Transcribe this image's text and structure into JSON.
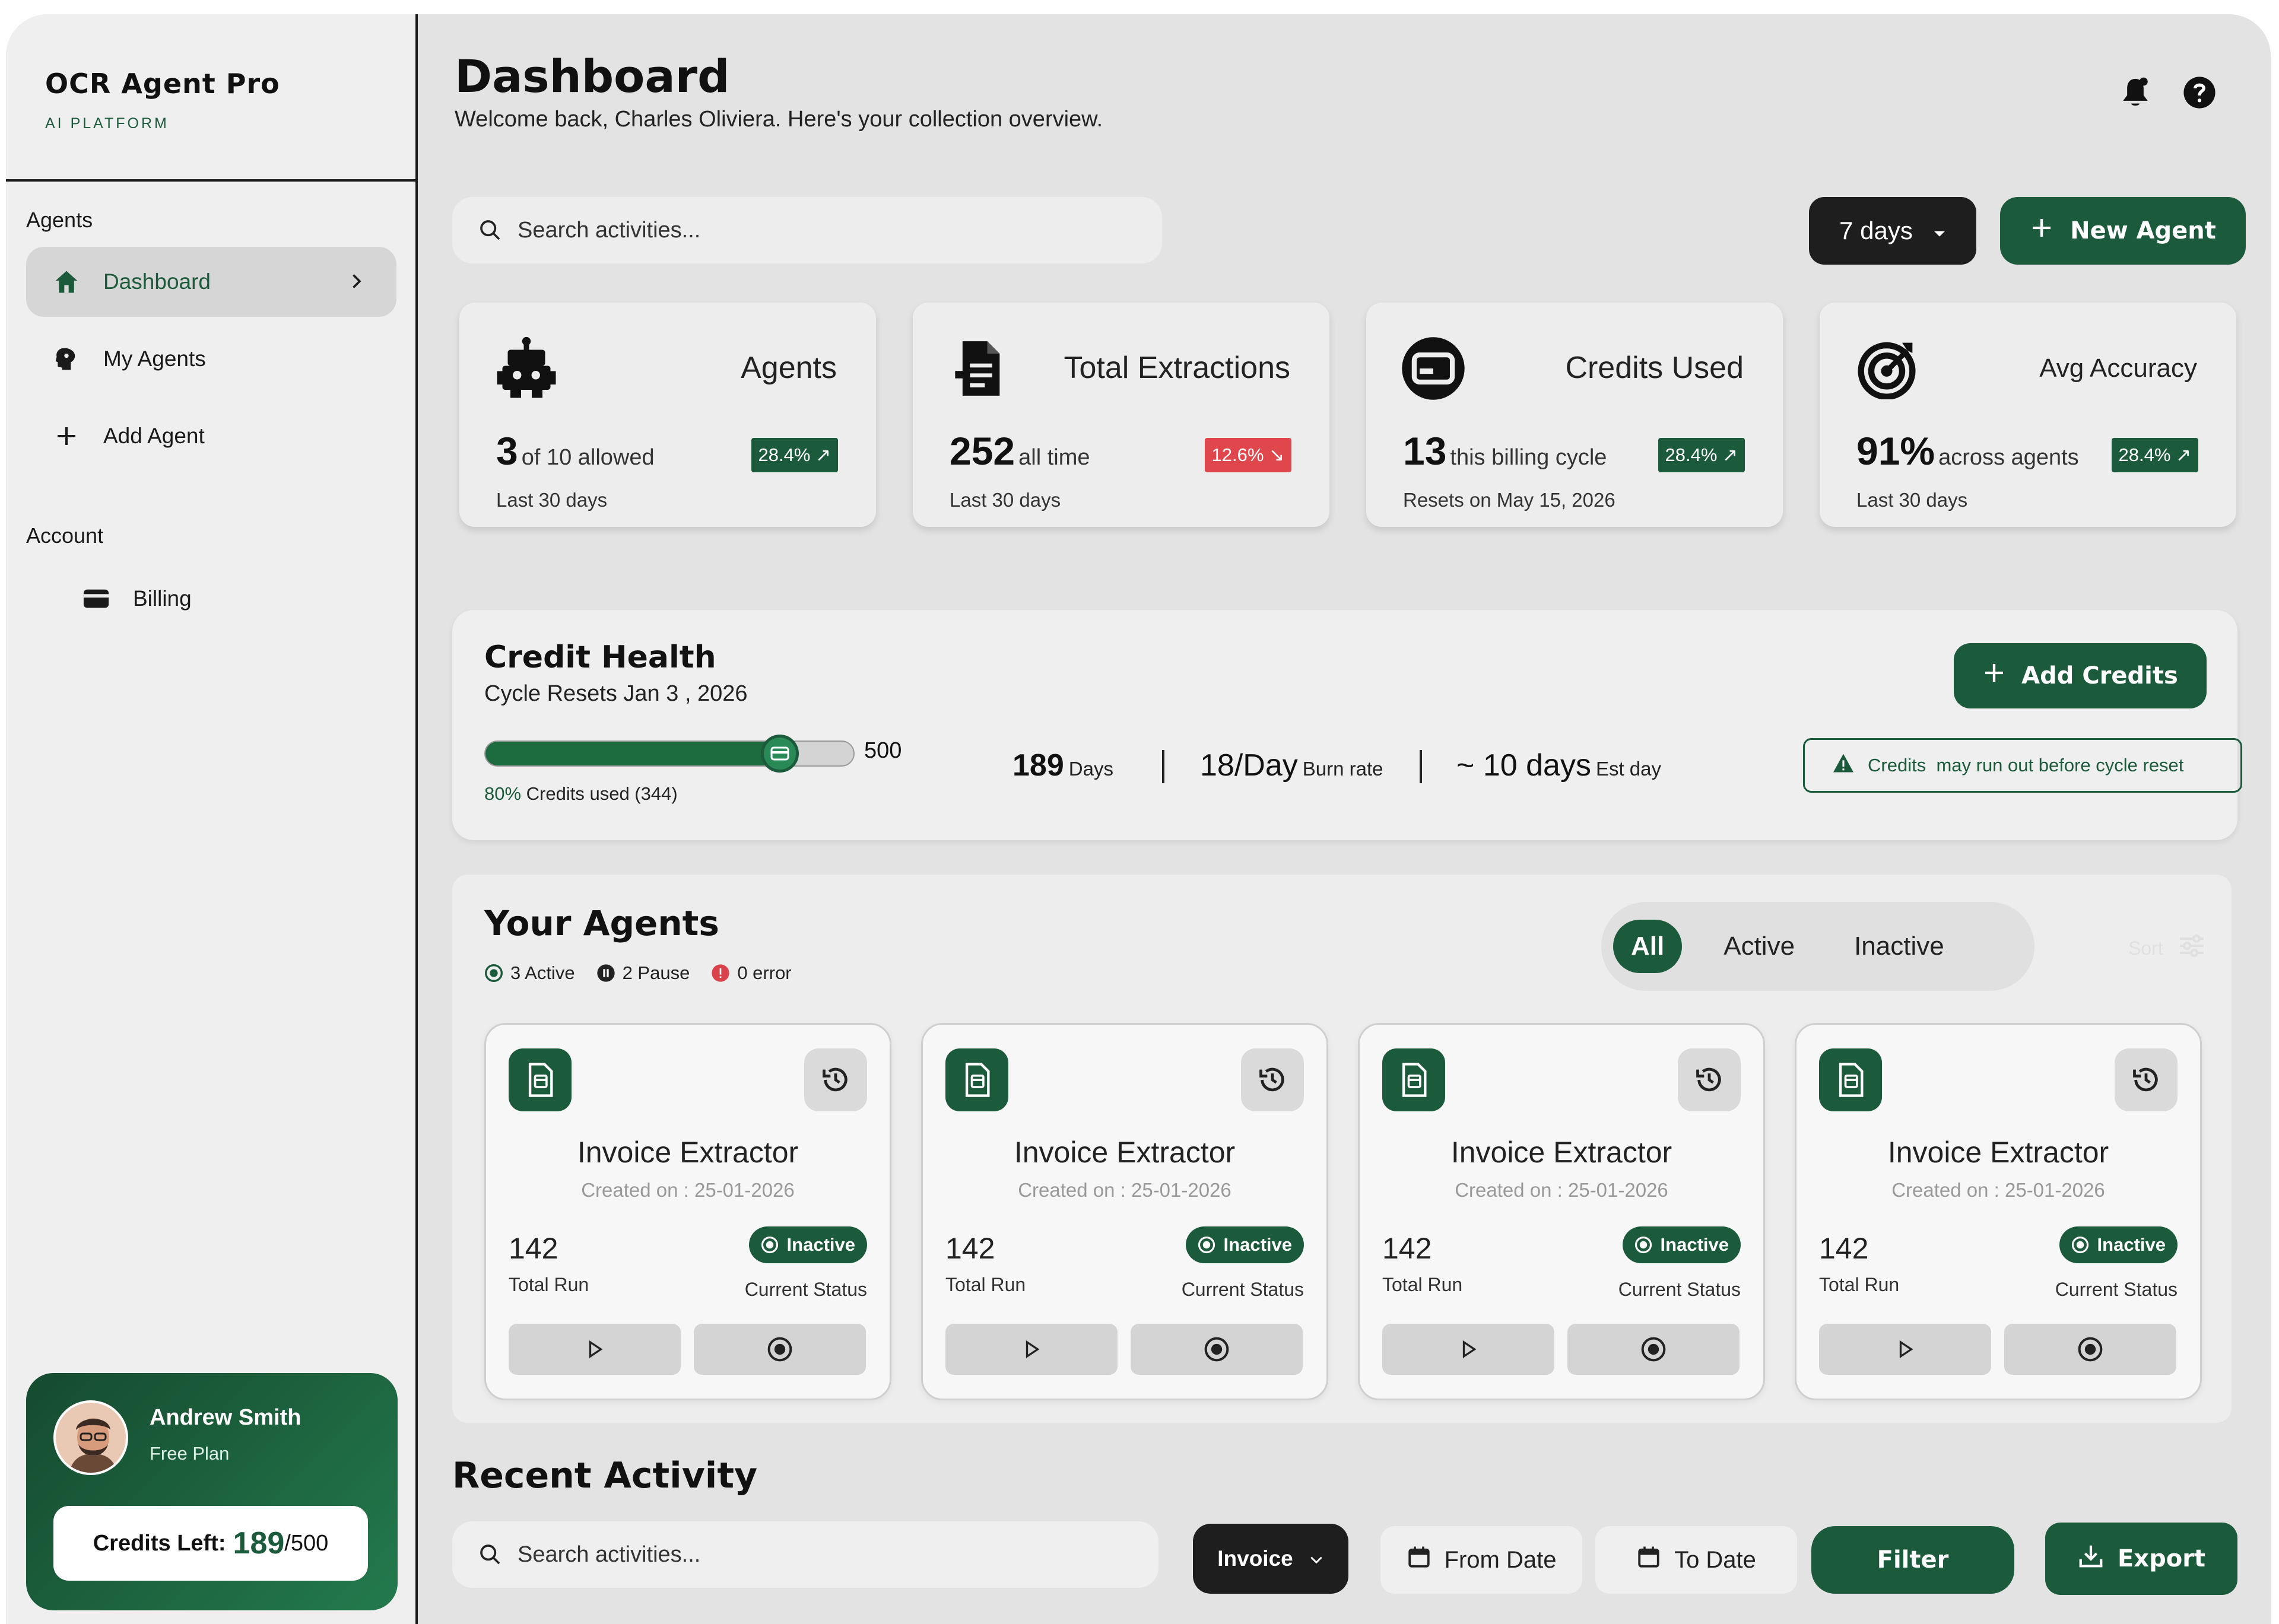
{
  "brand": {
    "name": "OCR Agent Pro",
    "sub": "AI PLATFORM"
  },
  "sidebar": {
    "agents_label": "Agents",
    "items": [
      {
        "label": "Dashboard",
        "icon": "home-icon",
        "active": true
      },
      {
        "label": "My Agents",
        "icon": "brain-icon"
      },
      {
        "label": "Add Agent",
        "icon": "plus-icon"
      }
    ],
    "account_label": "Account",
    "account_items": [
      {
        "label": "Billing",
        "icon": "card-icon"
      }
    ],
    "user": {
      "name": "Andrew Smith",
      "plan": "Free Plan",
      "credits_label": "Credits Left:",
      "credits_left": "189",
      "credits_total": "/500"
    }
  },
  "header": {
    "title": "Dashboard",
    "subtitle": "Welcome back, Charles Oliviera. Here's your collection overview."
  },
  "toolbar": {
    "search_placeholder": "Search activities...",
    "range": "7 days",
    "new_agent": "New Agent"
  },
  "stats": [
    {
      "title": "Agents",
      "value": "3",
      "unit": "of 10 allowed",
      "badge": "28.4%",
      "trend": "up",
      "foot": "Last 30 days",
      "icon": "robot-icon"
    },
    {
      "title": "Total Extractions",
      "value": "252",
      "unit": "all time",
      "badge": "12.6%",
      "trend": "down",
      "foot": "Last 30 days",
      "icon": "document-icon"
    },
    {
      "title": "Credits Used",
      "value": "13",
      "unit": "this billing cycle",
      "badge": "28.4%",
      "trend": "up",
      "foot": "Resets on May 15, 2026",
      "icon": "credit-card-icon"
    },
    {
      "title": "Avg Accuracy",
      "value": "91%",
      "unit": "across agents",
      "badge": "28.4%",
      "trend": "up",
      "foot": "Last 30 days",
      "icon": "target-icon"
    }
  ],
  "credit_health": {
    "title": "Credit Health",
    "subtitle": "Cycle Resets Jan 3 , 2026",
    "progress_fraction": 0.8,
    "max": "500",
    "used_pct": "80%",
    "used_label": "Credits used (344)",
    "days_value": "189",
    "days_label": "Days",
    "burn_value": "18/Day",
    "burn_label": "Burn rate",
    "est_value": "~ 10 days",
    "est_label": "Est day",
    "add_credits": "Add Credits",
    "warning_strong": "Credits",
    "warning_text": "may run out before cycle reset"
  },
  "agents_panel": {
    "title": "Your Agents",
    "legend": [
      {
        "label": "3 Active",
        "color": "#1c5a3c"
      },
      {
        "label": "2 Pause",
        "color": "#222222"
      },
      {
        "label": "0 error",
        "color": "#d9424a"
      }
    ],
    "tabs": [
      "All",
      "Active",
      "Inactive"
    ],
    "active_tab": "All",
    "sort_label": "Sort",
    "cards": [
      {
        "name": "Invoice Extractor",
        "created": "Created on : 25-01-2026",
        "runs": "142",
        "runs_label": "Total Run",
        "status": "Inactive",
        "status_label": "Current Status"
      },
      {
        "name": "Invoice Extractor",
        "created": "Created on : 25-01-2026",
        "runs": "142",
        "runs_label": "Total Run",
        "status": "Inactive",
        "status_label": "Current Status"
      },
      {
        "name": "Invoice Extractor",
        "created": "Created on : 25-01-2026",
        "runs": "142",
        "runs_label": "Total Run",
        "status": "Inactive",
        "status_label": "Current Status"
      },
      {
        "name": "Invoice Extractor",
        "created": "Created on : 25-01-2026",
        "runs": "142",
        "runs_label": "Total Run",
        "status": "Inactive",
        "status_label": "Current Status"
      }
    ]
  },
  "recent_activity": {
    "title": "Recent Activity",
    "search_placeholder": "Search activities...",
    "type": "Invoice",
    "from_date": "From Date",
    "to_date": "To Date",
    "filter": "Filter",
    "export": "Export"
  },
  "colors": {
    "brand_green": "#1c5a3c",
    "danger": "#e0474c",
    "background": "#e3e3e3"
  }
}
